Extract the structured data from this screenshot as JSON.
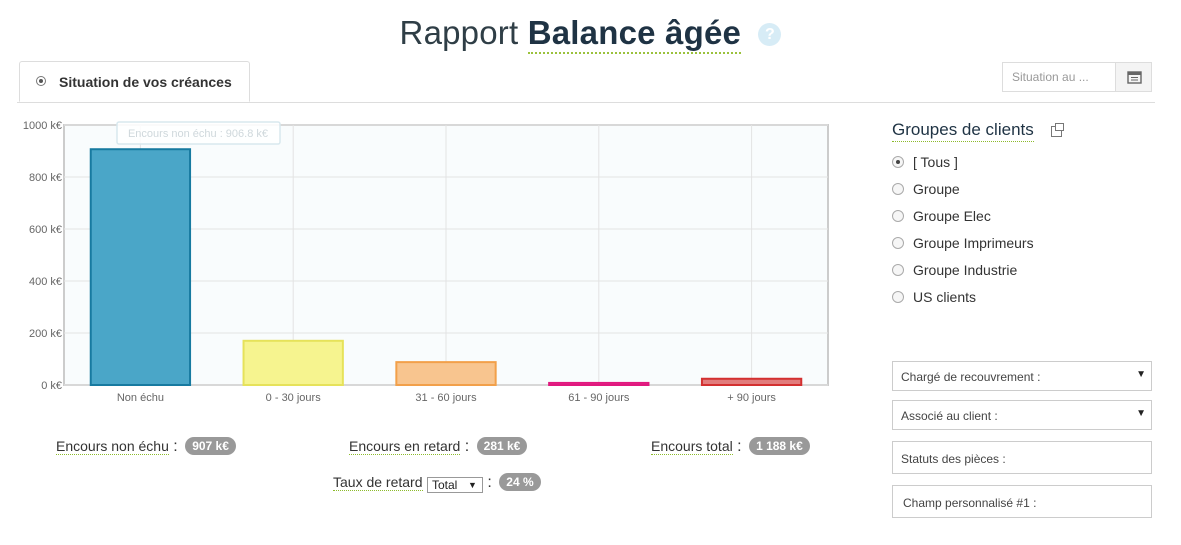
{
  "page": {
    "title_light": "Rapport",
    "title_bold": "Balance âgée",
    "help_icon": "?"
  },
  "tab": {
    "label": "Situation de vos créances"
  },
  "date": {
    "placeholder": "Situation au ..."
  },
  "chart_data": {
    "type": "bar",
    "categories": [
      "Non échu",
      "0 - 30 jours",
      "31 - 60 jours",
      "61 - 90 jours",
      "+ 90 jours"
    ],
    "values": [
      906.8,
      170,
      88,
      8,
      24
    ],
    "colors": [
      "#4aa6c8",
      "#f6f48f",
      "#f8c58f",
      "#f26bb0",
      "#e27c7c"
    ],
    "edge_colors": [
      "#177aa0",
      "#e6e25a",
      "#f2a04a",
      "#e0187e",
      "#d33030"
    ],
    "y_ticks": [
      "0 k€",
      "200 k€",
      "400 k€",
      "600 k€",
      "800 k€",
      "1000 k€"
    ],
    "ylim": [
      0,
      1000
    ],
    "grid": true,
    "tooltip": "Encours non échu : 906.8 k€"
  },
  "summary": {
    "non_echu_label": "Encours non échu",
    "non_echu_value": "907 k€",
    "retard_label": "Encours en retard",
    "retard_value": "281 k€",
    "total_label": "Encours total",
    "total_value": "1 188 k€",
    "taux_label": "Taux de retard",
    "taux_select": "Total",
    "taux_value": "24 %"
  },
  "groups": {
    "title": "Groupes de clients",
    "items": [
      {
        "label": "[ Tous ]",
        "checked": true
      },
      {
        "label": "Groupe"
      },
      {
        "label": "Groupe Elec"
      },
      {
        "label": "Groupe Imprimeurs"
      },
      {
        "label": "Groupe Industrie"
      },
      {
        "label": "US clients"
      }
    ]
  },
  "filters": {
    "charge": "Chargé de recouvrement :",
    "associe": "Associé au client :",
    "statuts": "Statuts des pièces :",
    "champ": "Champ personnalisé #1 :"
  }
}
